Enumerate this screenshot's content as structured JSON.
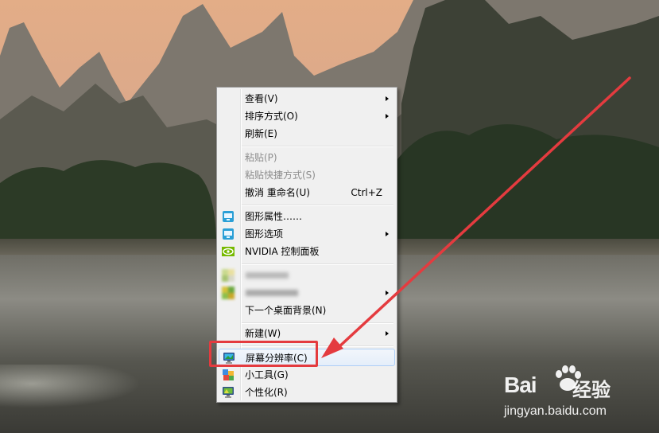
{
  "menu": {
    "view": "查看(V)",
    "sort": "排序方式(O)",
    "refresh": "刷新(E)",
    "paste": "粘贴(P)",
    "paste_shortcut": "粘贴快捷方式(S)",
    "undo": "撤消 重命名(U)",
    "undo_shortcut": "Ctrl+Z",
    "graphics_properties": "图形属性……",
    "graphics_options": "图形选项",
    "nvidia": "NVIDIA 控制面板",
    "next_background": "下一个桌面背景(N)",
    "new": "新建(W)",
    "screen_resolution": "屏幕分辨率(C)",
    "gadgets": "小工具(G)",
    "personalize": "个性化(R)"
  },
  "watermark": {
    "brand": "Bai",
    "brand_suffix": "经验",
    "url": "jingyan.baidu.com"
  },
  "colors": {
    "annotation": "#e43b3f",
    "menu_background": "#f0f0f0",
    "highlight_border": "#aecff7"
  }
}
